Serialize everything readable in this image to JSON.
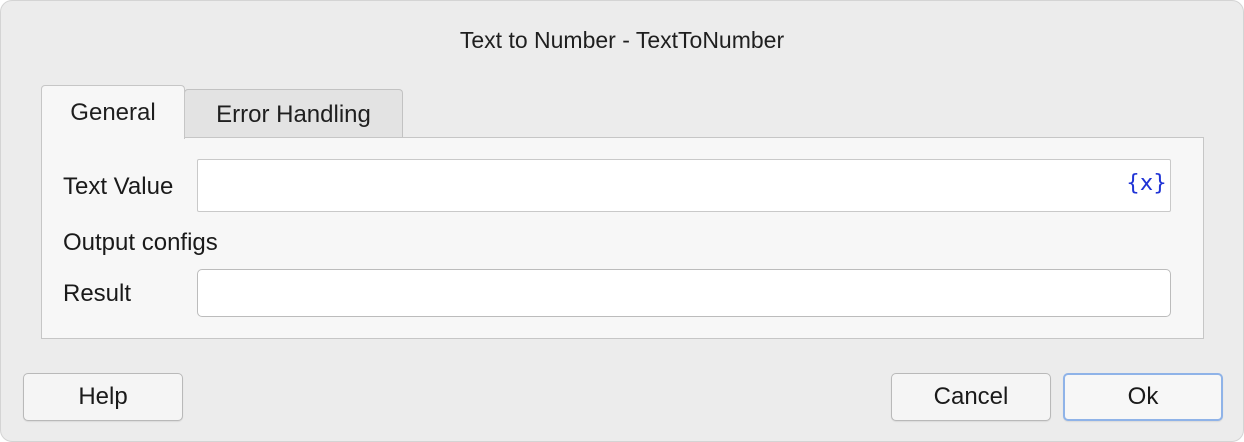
{
  "dialog": {
    "title": "Text to Number - TextToNumber"
  },
  "tabs": [
    {
      "label": "General",
      "active": true
    },
    {
      "label": "Error Handling",
      "active": false
    }
  ],
  "general": {
    "text_value_label": "Text Value",
    "text_value": "",
    "variable_icon": "{x}",
    "output_configs_label": "Output configs",
    "result_label": "Result",
    "result_value": ""
  },
  "buttons": {
    "help": "Help",
    "cancel": "Cancel",
    "ok": "Ok"
  },
  "colors": {
    "variable_icon": "#1f33d6",
    "default_button_border": "#8fb3e8",
    "dialog_background": "#ececec"
  }
}
